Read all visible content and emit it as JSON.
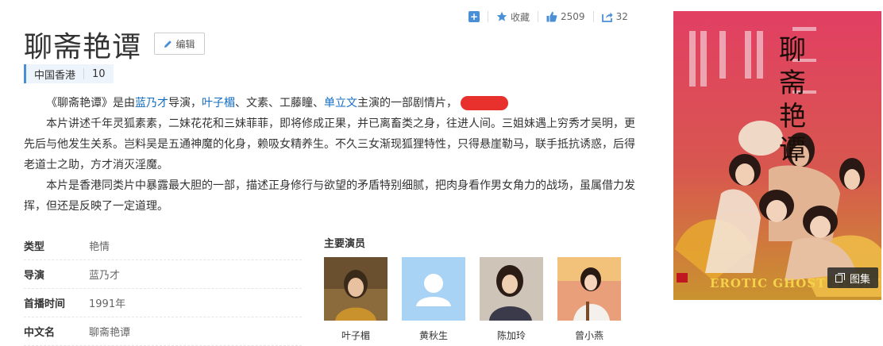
{
  "topbar": {
    "favorite_label": "收藏",
    "like_count": "2509",
    "share_count": "32"
  },
  "title": "聊斋艳谭",
  "edit_label": "编辑",
  "meta": {
    "region": "中国香港",
    "rating": "10"
  },
  "desc": {
    "p1_pre": "《聊斋艳谭》是由",
    "p1_director": "蓝乃才",
    "p1_mid": "导演，",
    "p1_actor1": "叶子楣",
    "p1_sep1": "、文素、工藤瞳、",
    "p1_actor2": "单立文",
    "p1_post": "主演的一部剧情片，",
    "p2": "本片讲述千年灵狐素素，二妹花花和三妹菲菲，即将修成正果，并已离畜类之身，往进人间。三姐妹遇上穷秀才吴明，更先后与他发生关系。岂料吴是五通神魔的化身，赖吸女精养生。不久三女渐现狐狸特性，只得悬崖勒马，联手抵抗诱惑，后得老道士之助，方才消灭淫魔。",
    "p3": "本片是香港同类片中暴露最大胆的一部，描述正身修行与欲望的矛盾特别细腻，把肉身看作男女角力的战场，虽属借力发挥，但还是反映了一定道理。"
  },
  "info": [
    {
      "key": "类型",
      "value": "艳情"
    },
    {
      "key": "导演",
      "value": "蓝乃才"
    },
    {
      "key": "首播时间",
      "value": "1991年"
    },
    {
      "key": "中文名",
      "value": "聊斋艳谭"
    }
  ],
  "actors_title": "主要演员",
  "actors": [
    {
      "name": "叶子楣"
    },
    {
      "name": "黄秋生"
    },
    {
      "name": "陈加玲"
    },
    {
      "name": "曾小燕"
    }
  ],
  "poster": {
    "vertical_title": "聊斋艳谭",
    "english_title": "EROTIC GHOST STORY",
    "gallery_label": "图集"
  }
}
